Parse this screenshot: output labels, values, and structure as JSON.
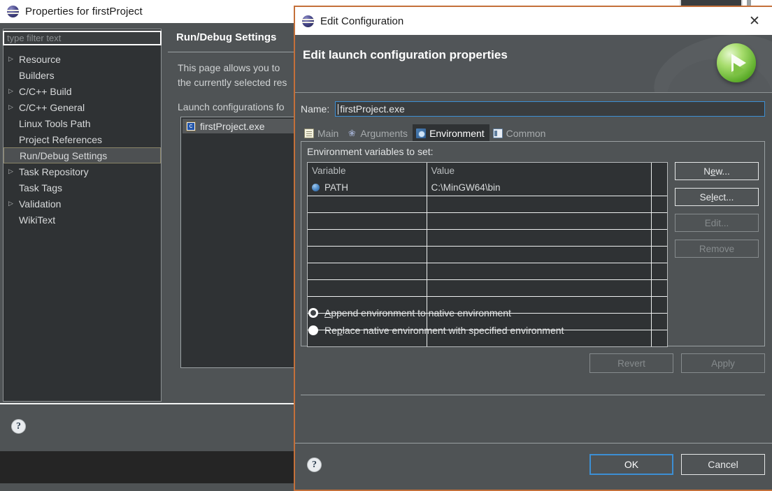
{
  "background_window": {
    "title": "Properties for firstProject",
    "icon": "eclipse-icon",
    "filter": {
      "placeholder": "type filter text",
      "value": ""
    },
    "tree": {
      "items": [
        {
          "label": "Resource",
          "expandable": true,
          "selected": false
        },
        {
          "label": "Builders",
          "expandable": false,
          "selected": false
        },
        {
          "label": "C/C++ Build",
          "expandable": true,
          "selected": false
        },
        {
          "label": "C/C++ General",
          "expandable": true,
          "selected": false
        },
        {
          "label": "Linux Tools Path",
          "expandable": false,
          "selected": false
        },
        {
          "label": "Project References",
          "expandable": false,
          "selected": false
        },
        {
          "label": "Run/Debug Settings",
          "expandable": false,
          "selected": true
        },
        {
          "label": "Task Repository",
          "expandable": true,
          "selected": false
        },
        {
          "label": "Task Tags",
          "expandable": false,
          "selected": false
        },
        {
          "label": "Validation",
          "expandable": true,
          "selected": false
        },
        {
          "label": "WikiText",
          "expandable": false,
          "selected": false
        }
      ]
    },
    "page": {
      "title": "Run/Debug Settings",
      "description_line1": "This page allows you to",
      "description_line2": "the currently selected res",
      "launch_label": "Launch configurations fo",
      "launch_items": [
        {
          "label": "firstProject.exe",
          "icon": "c-file-icon",
          "selected": true
        }
      ]
    },
    "help_icon": "help-icon"
  },
  "dialog": {
    "title": "Edit Configuration",
    "title_icon": "eclipse-icon",
    "close_label": "✕",
    "banner": {
      "heading": "Edit launch configuration properties",
      "icon": "run-icon"
    },
    "name": {
      "label": "Name:",
      "value": "firstProject.exe"
    },
    "tabs": [
      {
        "label": "Main",
        "icon": "document-icon",
        "active": false
      },
      {
        "label": "Arguments",
        "icon": "arguments-icon",
        "active": false
      },
      {
        "label": "Environment",
        "icon": "environment-icon",
        "active": true
      },
      {
        "label": "Common",
        "icon": "common-icon",
        "active": false
      }
    ],
    "environment": {
      "section_label": "Environment variables to set:",
      "columns": [
        "Variable",
        "Value",
        ""
      ],
      "rows": [
        {
          "variable": "PATH",
          "value": "C:\\MinGW64\\bin",
          "icon": "variable-dot-icon"
        }
      ],
      "empty_row_count": 9,
      "side_buttons": [
        {
          "label": "New...",
          "mnemonic": "e",
          "enabled": true
        },
        {
          "label": "Select...",
          "mnemonic": "l",
          "enabled": true
        },
        {
          "label": "Edit...",
          "mnemonic": "",
          "enabled": false
        },
        {
          "label": "Remove",
          "mnemonic": "",
          "enabled": false
        }
      ],
      "radios": [
        {
          "label": "Append environment to native environment",
          "mnemonic": "A",
          "selected": true
        },
        {
          "label": "Replace native environment with specified environment",
          "mnemonic": "p",
          "selected": false
        }
      ]
    },
    "action_buttons": [
      {
        "label": "Revert",
        "enabled": false
      },
      {
        "label": "Apply",
        "enabled": false
      }
    ],
    "footer": {
      "help_icon": "help-icon",
      "ok_label": "OK",
      "cancel_label": "Cancel"
    }
  },
  "colors": {
    "dialog_border": "#c4703a",
    "focus_blue": "#3c8fd4",
    "panel_bg": "#4f5355",
    "field_bg": "#2f3234",
    "selection_gold": "#8a8468"
  }
}
